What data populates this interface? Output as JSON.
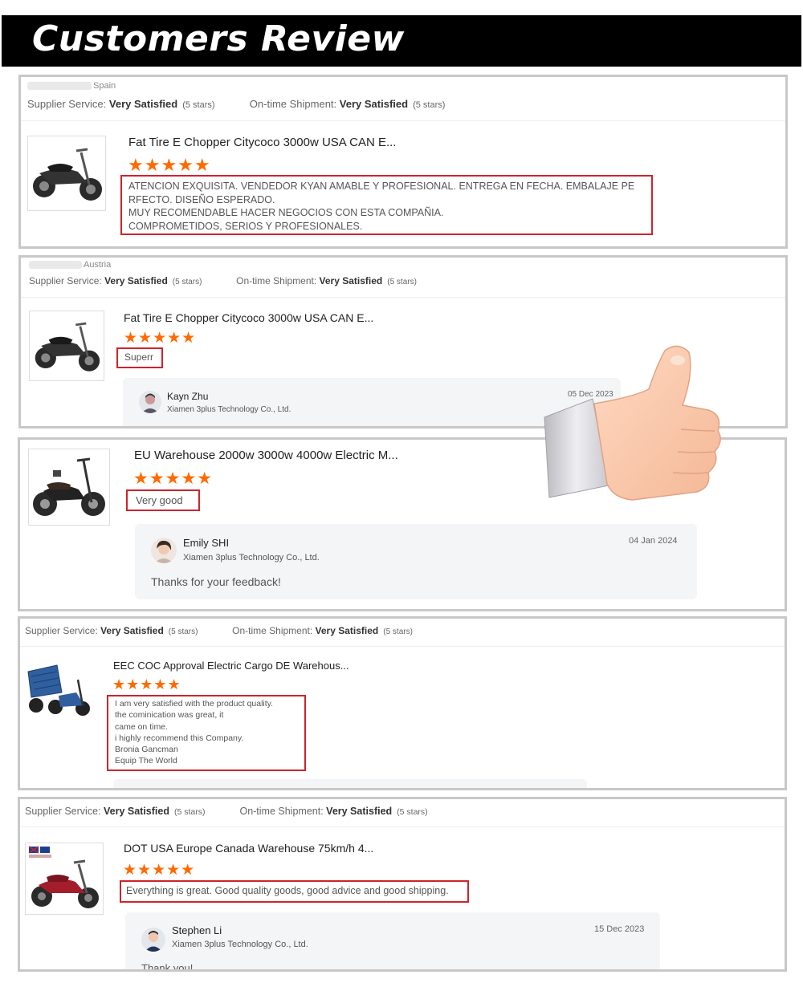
{
  "banner": {
    "title": "Customers Review"
  },
  "icons": {
    "star": "star-icon",
    "thumb": "thumbs-up-icon",
    "avatar": "user-avatar"
  },
  "colors": {
    "star": "#ff6a00",
    "highlight": "#d0232b",
    "banner": "#000000",
    "border": "#c8c8c8"
  },
  "reviews": [
    {
      "location": "Spain",
      "supplier_label": "Supplier Service:",
      "supplier_value": "Very Satisfied",
      "supplier_stars": "(5 stars)",
      "shipment_label": "On-time Shipment:",
      "shipment_value": "Very Satisfied",
      "shipment_stars": "(5 stars)",
      "product_title": "Fat Tire E Chopper Citycoco 3000w USA CAN E...",
      "stars": "★★★★★",
      "rating": 5,
      "text": "ATENCION EXQUISITA. VENDEDOR KYAN AMABLE Y PROFESIONAL. ENTREGA EN FECHA. EMBALAJE PE\nRFECTO. DISEÑO ESPERADO.\nMUY RECOMENDABLE HACER NEGOCIOS CON ESTA COMPAÑIA.\nCOMPROMETIDOS, SERIOS Y PROFESIONALES."
    },
    {
      "location": "Austria",
      "supplier_label": "Supplier Service:",
      "supplier_value": "Very Satisfied",
      "supplier_stars": "(5 stars)",
      "shipment_label": "On-time Shipment:",
      "shipment_value": "Very Satisfied",
      "shipment_stars": "(5 stars)",
      "product_title": "Fat Tire E Chopper Citycoco 3000w USA CAN E...",
      "stars": "★★★★★",
      "rating": 5,
      "text": "Superr",
      "reply": {
        "name": "Kayn Zhu",
        "company": "Xiamen 3plus Technology Co., Ltd.",
        "date": "05 Dec 2023"
      }
    },
    {
      "product_title": "EU Warehouse 2000w 3000w 4000w Electric M...",
      "stars": "★★★★★",
      "rating": 5,
      "text": "Very good",
      "reply": {
        "name": "Emily SHI",
        "company": "Xiamen 3plus Technology Co., Ltd.",
        "date": "04 Jan 2024",
        "message": "Thanks for your feedback!"
      }
    },
    {
      "supplier_label": "Supplier Service:",
      "supplier_value": "Very Satisfied",
      "supplier_stars": "(5 stars)",
      "shipment_label": "On-time Shipment:",
      "shipment_value": "Very Satisfied",
      "shipment_stars": "(5 stars)",
      "product_title": "EEC COC Approval Electric Cargo DE Warehous...",
      "stars": "★★★★★",
      "rating": 5,
      "text": "I am very satisfied with the product quality.\nthe cominication was great, it\ncame on time.\ni highly recommend this Company.\nBronia Gancman\nEquip The World"
    },
    {
      "supplier_label": "Supplier Service:",
      "supplier_value": "Very Satisfied",
      "supplier_stars": "(5 stars)",
      "shipment_label": "On-time Shipment:",
      "shipment_value": "Very Satisfied",
      "shipment_stars": "(5 stars)",
      "product_title": "DOT USA Europe Canada Warehouse 75km/h 4...",
      "stars": "★★★★★",
      "rating": 5,
      "text": "Everything is great. Good quality goods, good advice and good shipping.",
      "reply": {
        "name": "Stephen Li",
        "company": "Xiamen 3plus Technology Co., Ltd.",
        "date": "15 Dec 2023",
        "message": "Thank you!"
      }
    }
  ]
}
